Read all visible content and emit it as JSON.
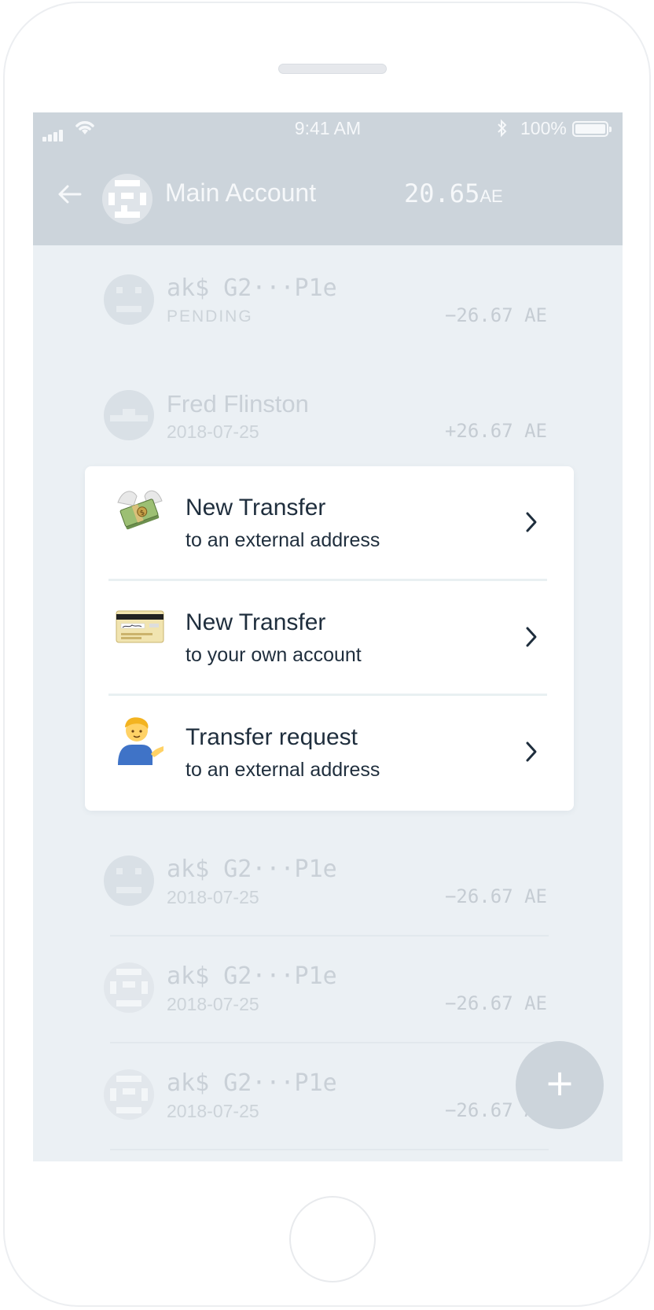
{
  "status_bar": {
    "time": "9:41 AM",
    "battery_percent": "100%",
    "battery_level": 1.0
  },
  "header": {
    "back_icon": "arrow-left-icon",
    "account_name": "Main Account",
    "balance": "20.65",
    "balance_unit": "AE"
  },
  "transactions": [
    {
      "name": "ak$ G2···P1e",
      "sub": "PENDING",
      "amount": "−26.67 AE"
    },
    {
      "name": "Fred Flinston",
      "sub": "2018-07-25",
      "amount": "+26.67 AE"
    },
    {
      "name": "ak$ G2···P1e",
      "sub": "2018-07-25",
      "amount": "−26.67 AE"
    },
    {
      "name": "ak$ G2···P1e",
      "sub": "2018-07-25",
      "amount": "−26.67 AE"
    },
    {
      "name": "ak$ G2···P1e",
      "sub": "2018-07-25",
      "amount": "−26.67 AE"
    }
  ],
  "menu": {
    "items": [
      {
        "title": "New Transfer",
        "subtitle": "to an external address",
        "icon": "money-with-wings-icon"
      },
      {
        "title": "New Transfer",
        "subtitle": "to your own account",
        "icon": "credit-card-icon"
      },
      {
        "title": "Transfer request",
        "subtitle": "to an external address",
        "icon": "person-tipping-hand-icon"
      }
    ]
  },
  "fab": {
    "label": "+",
    "icon": "plus-icon"
  },
  "colors": {
    "header_bg": "#ccd4db",
    "screen_bg": "#ebf0f4",
    "menu_text": "#1f2e3d",
    "faded_text": "#c9d0d7"
  }
}
